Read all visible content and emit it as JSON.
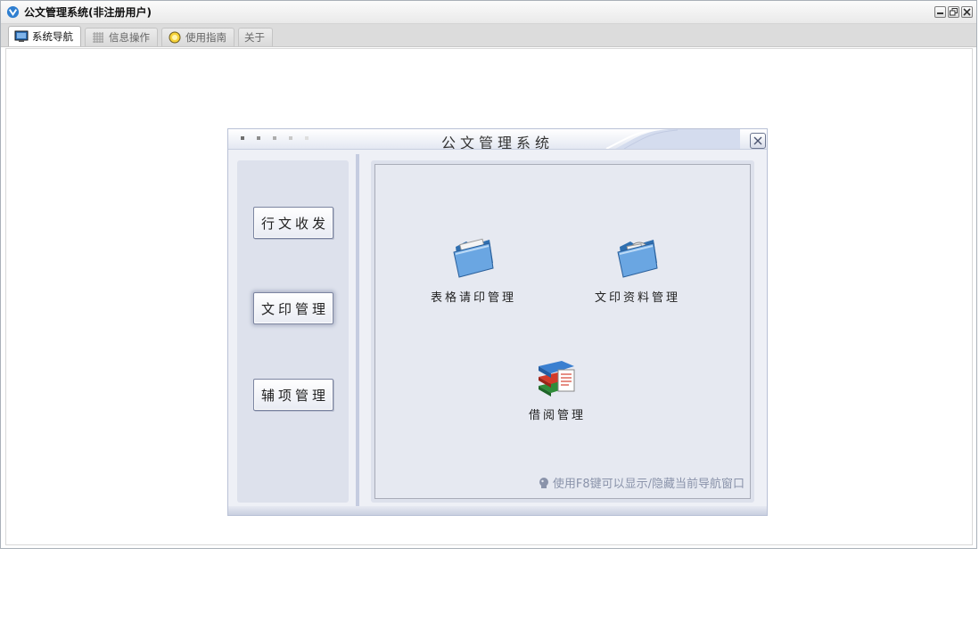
{
  "window": {
    "title": "公文管理系统(非注册用户)",
    "controls": [
      "minimize-icon",
      "restore-icon",
      "close-icon"
    ]
  },
  "tabs": [
    {
      "label": "系统导航",
      "icon": "monitor-icon",
      "active": true
    },
    {
      "label": "信息操作",
      "icon": "grid-icon",
      "active": false
    },
    {
      "label": "使用指南",
      "icon": "bulb-icon",
      "active": false
    },
    {
      "label": "关于",
      "icon": "",
      "active": false
    }
  ],
  "nav_panel": {
    "title": "公文管理系统",
    "side_buttons": [
      {
        "label": "行文收发"
      },
      {
        "label": "文印管理",
        "selected": true
      },
      {
        "label": "辅项管理"
      }
    ],
    "modules": [
      {
        "label": "表格请印管理",
        "icon": "folder-icon"
      },
      {
        "label": "文印资料管理",
        "icon": "folder-cd-icon"
      },
      {
        "label": "借阅管理",
        "icon": "books-icon"
      }
    ],
    "hint": "使用F8键可以显示/隐藏当前导航窗口"
  },
  "colors": {
    "panel_bg": "#eef0f6",
    "column_bg": "#dde1ec",
    "hint_text": "#8a93aa"
  }
}
